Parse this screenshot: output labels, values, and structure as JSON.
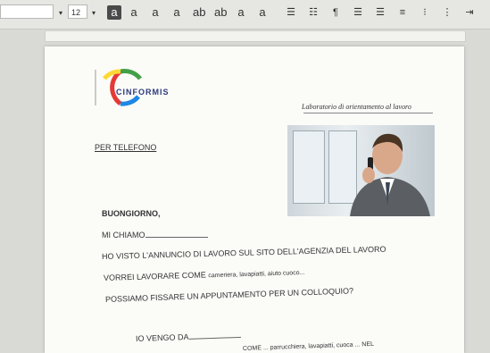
{
  "toolbar": {
    "font_size": "12",
    "buttons": [
      {
        "name": "bold-button",
        "label": "a",
        "boxed": true
      },
      {
        "name": "italic-button",
        "label": "a",
        "boxed": false
      },
      {
        "name": "underline-button",
        "label": "a",
        "boxed": false
      },
      {
        "name": "strikethrough-button",
        "label": "a",
        "boxed": false
      },
      {
        "name": "superscript-button",
        "label": "ab",
        "boxed": false
      },
      {
        "name": "subscript-button",
        "label": "ab",
        "boxed": false
      },
      {
        "name": "font-color-button",
        "label": "a",
        "boxed": false
      },
      {
        "name": "highlight-button",
        "label": "a",
        "boxed": false
      }
    ]
  },
  "document": {
    "logo_text": "CINFORMIS",
    "header_right": "Laboratorio di orientamento al lavoro",
    "section_title": "PER TELEFONO",
    "lines": [
      "BUONGIORNO,",
      "MI CHIAMO",
      "HO VISTO L'ANNUNCIO DI LAVORO SUL SITO DELL'AGENZIA DEL LAVORO",
      "VORREI LAVORARE COME",
      "cameriera, lavapiatti, aiuto cuoco...",
      "POSSIAMO FISSARE UN APPUNTAMENTO PER UN COLLOQUIO?",
      "IO VENGO DA",
      "COME ... parrucchiera, lavapiatti, cuoca ... NEL"
    ]
  }
}
